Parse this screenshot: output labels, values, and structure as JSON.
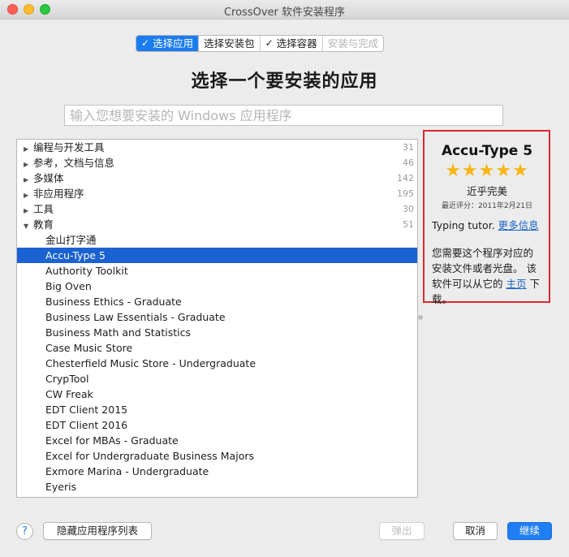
{
  "window": {
    "title": "CrossOver 软件安装程序"
  },
  "steps": [
    {
      "label": "选择应用",
      "checked": true,
      "state": "active"
    },
    {
      "label": "选择安装包",
      "checked": false,
      "state": "normal"
    },
    {
      "label": "选择容器",
      "checked": true,
      "state": "normal"
    },
    {
      "label": "安装与完成",
      "checked": false,
      "state": "disabled"
    }
  ],
  "heading": "选择一个要安装的应用",
  "search": {
    "placeholder": "输入您想要安装的 Windows 应用程序",
    "value": ""
  },
  "categories": [
    {
      "label": "编程与开发工具",
      "count": "31",
      "expanded": false
    },
    {
      "label": "参考，文档与信息",
      "count": "46",
      "expanded": false
    },
    {
      "label": "多媒体",
      "count": "142",
      "expanded": false
    },
    {
      "label": "非应用程序",
      "count": "195",
      "expanded": false
    },
    {
      "label": "工具",
      "count": "30",
      "expanded": false
    },
    {
      "label": "教育",
      "count": "51",
      "expanded": true
    }
  ],
  "apps": [
    "金山打字通",
    "Accu-Type 5",
    "Authority Toolkit",
    "Big Oven",
    "Business Ethics - Graduate",
    "Business Law Essentials - Graduate",
    "Business Math and Statistics",
    "Case Music Store",
    "Chesterfield Music Store - Undergraduate",
    "CrypTool",
    "CW Freak",
    "EDT Client 2015",
    "EDT Client 2016",
    "Excel for MBAs - Graduate",
    "Excel for Undergraduate Business Majors",
    "Exmore Marina - Undergraduate",
    "Eyeris"
  ],
  "selected_app": "Accu-Type 5",
  "info": {
    "name": "Accu-Type 5",
    "stars": 5,
    "stars_text": "★★★★★",
    "rating_label": "近乎完美",
    "rated_on": "最近评分：2011年2月21日",
    "description": "Typing tutor.",
    "more_link": "更多信息",
    "note_before": "您需要这个程序对应的安装文件或者光盘。 该软件可以从它的",
    "homepage_link": "主页",
    "note_after": "下载。"
  },
  "buttons": {
    "help": "?",
    "hide_list": "隐藏应用程序列表",
    "eject": "弹出",
    "cancel": "取消",
    "continue": "继续"
  },
  "colors": {
    "accent": "#1b7cf0",
    "selection": "#1a62d2",
    "highlight_border": "#d9292c",
    "star": "#f6b614"
  },
  "icons": {
    "expanded": "▼",
    "collapsed": "▶",
    "check": "✓"
  }
}
